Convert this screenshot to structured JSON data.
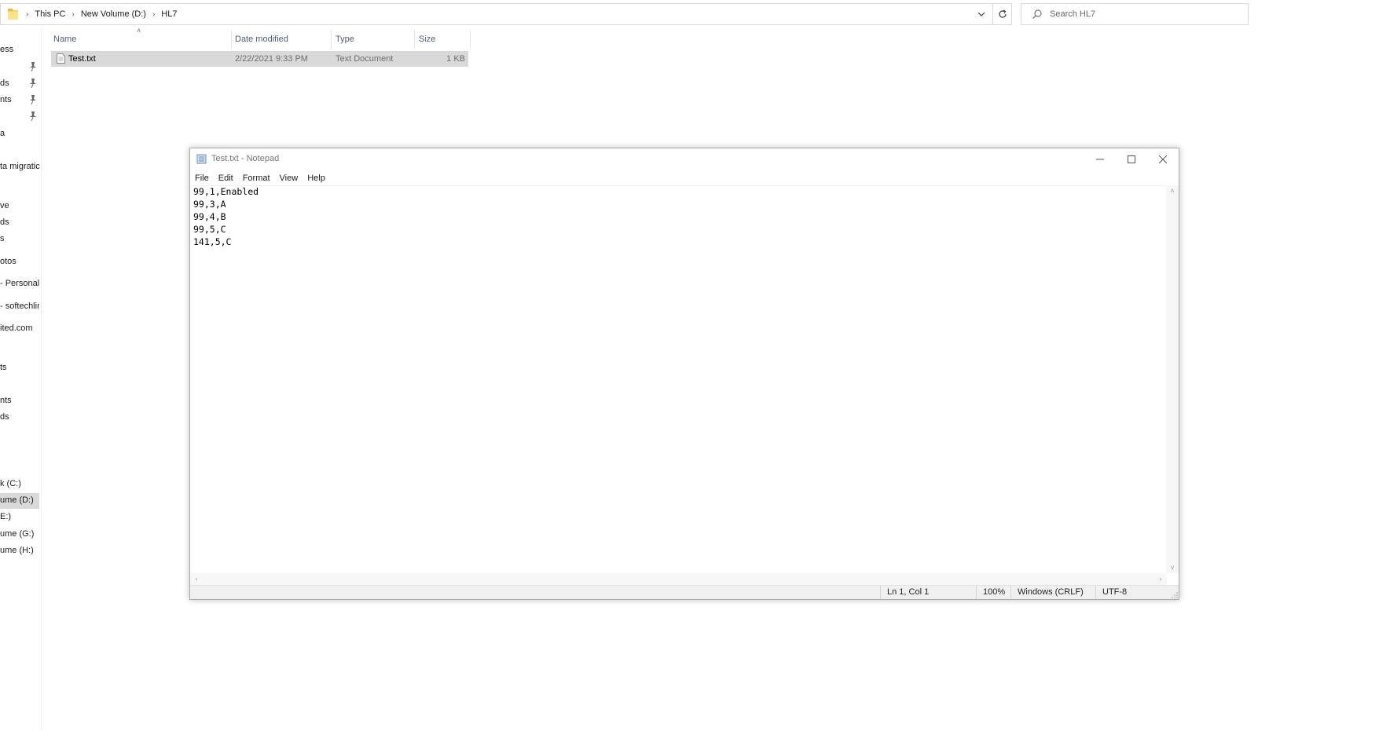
{
  "explorer": {
    "breadcrumb": [
      "This PC",
      "New Volume (D:)",
      "HL7"
    ],
    "search_placeholder": "Search HL7",
    "nav_items": [
      {
        "label": "ess"
      },
      {
        "label": ""
      },
      {
        "label": "ds"
      },
      {
        "label": "nts"
      },
      {
        "label": ""
      },
      {
        "label": "a"
      },
      {
        "label": "ta migratic"
      },
      {
        "label": "ve"
      },
      {
        "label": "ds"
      },
      {
        "label": "s"
      },
      {
        "label": "otos"
      },
      {
        "label": "- Personal"
      },
      {
        "label": "- softechlin"
      },
      {
        "label": "ited.com"
      },
      {
        "label": "ts"
      },
      {
        "label": "nts"
      },
      {
        "label": "ds"
      },
      {
        "label": "k (C:)"
      },
      {
        "label": "ume (D:)"
      },
      {
        "label": "E:)"
      },
      {
        "label": "ume (G:)"
      },
      {
        "label": "ume (H:)"
      }
    ],
    "columns": [
      "Name",
      "Date modified",
      "Type",
      "Size"
    ],
    "files": [
      {
        "name": "Test.txt",
        "date": "2/22/2021 9:33 PM",
        "type": "Text Document",
        "size": "1 KB"
      }
    ]
  },
  "notepad": {
    "title": "Test.txt - Notepad",
    "menu": [
      "File",
      "Edit",
      "Format",
      "View",
      "Help"
    ],
    "content": "99,1,Enabled\n99,3,A\n99,4,B\n99,5,C\n141,5,C",
    "status": {
      "position": "Ln 1, Col 1",
      "zoom": "100%",
      "line_ending": "Windows (CRLF)",
      "encoding": "UTF-8"
    }
  }
}
